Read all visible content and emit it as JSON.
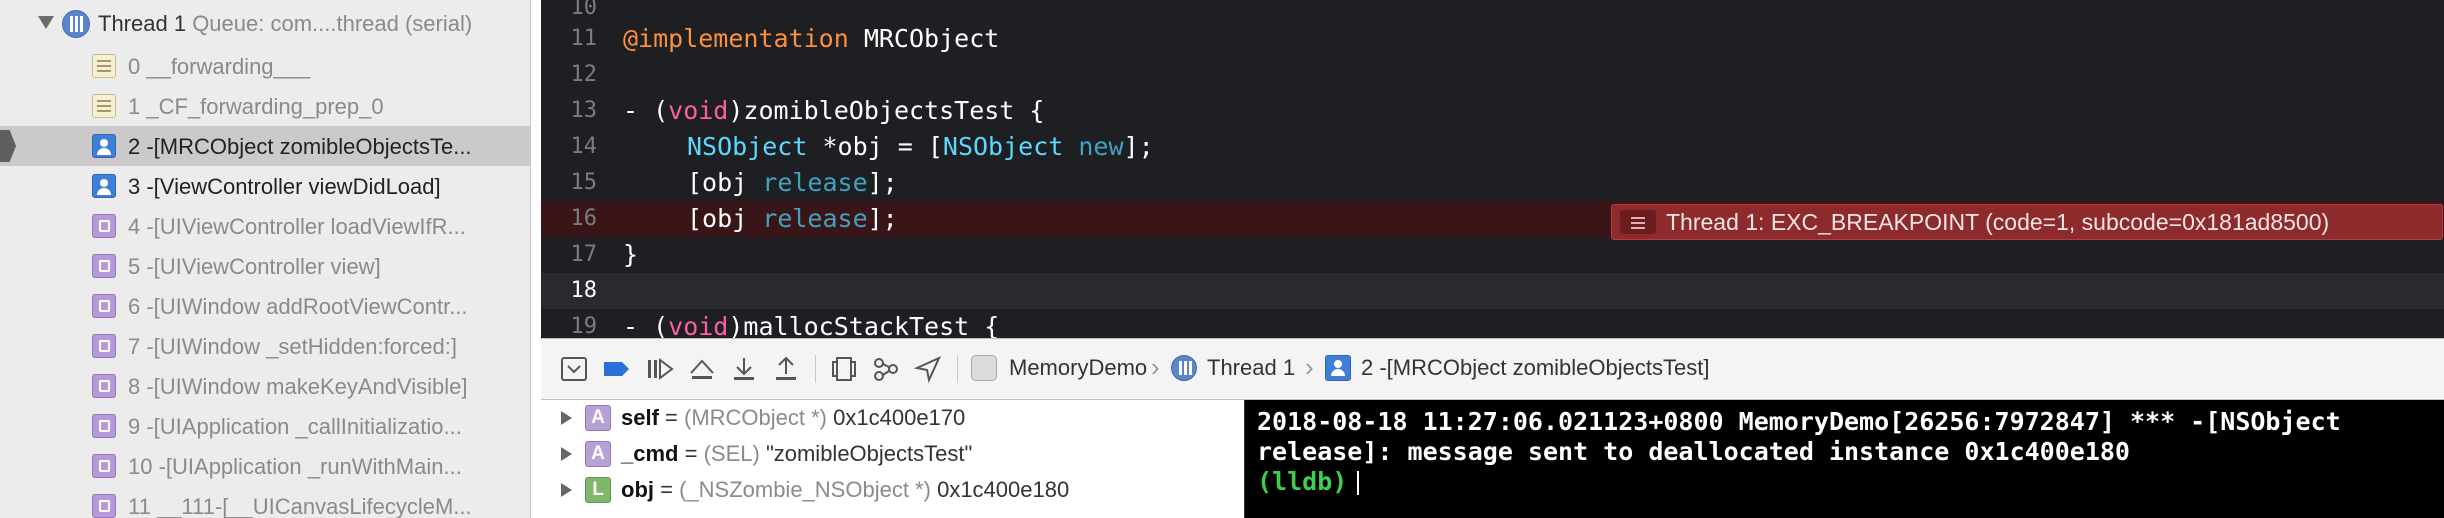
{
  "navigator": {
    "thread": {
      "name": "Thread 1",
      "queue": "Queue: com....thread (serial)"
    },
    "frames": [
      {
        "label": "0 __forwarding___",
        "icon": "system-frame-icon"
      },
      {
        "label": "1 _CF_forwarding_prep_0",
        "icon": "system-frame-icon"
      },
      {
        "label": "2 -[MRCObject zomibleObjectsTe...",
        "icon": "user-frame-icon",
        "selected": true
      },
      {
        "label": "3 -[ViewController viewDidLoad]",
        "icon": "user-frame-icon"
      },
      {
        "label": "4 -[UIViewController loadViewIfR...",
        "icon": "uikit-frame-icon"
      },
      {
        "label": "5 -[UIViewController view]",
        "icon": "uikit-frame-icon"
      },
      {
        "label": "6 -[UIWindow addRootViewContr...",
        "icon": "uikit-frame-icon"
      },
      {
        "label": "7 -[UIWindow _setHidden:forced:]",
        "icon": "uikit-frame-icon"
      },
      {
        "label": "8 -[UIWindow makeKeyAndVisible]",
        "icon": "uikit-frame-icon"
      },
      {
        "label": "9 -[UIApplication _callInitializatio...",
        "icon": "uikit-frame-icon"
      },
      {
        "label": "10 -[UIApplication _runWithMain...",
        "icon": "uikit-frame-icon"
      },
      {
        "label": "11 __111-[__UICanvasLifecycleM...",
        "icon": "uikit-frame-icon"
      }
    ]
  },
  "editor": {
    "lines": [
      {
        "num": "10"
      },
      {
        "num": "11",
        "directive": "@implementation",
        "rest": " MRCObject"
      },
      {
        "num": "12"
      },
      {
        "num": "13",
        "a": "- (",
        "kw": "void",
        "b": ")zomibleObjectsTest {"
      },
      {
        "num": "14",
        "cls1": "NSObject",
        "mid": " *obj = [",
        "cls2": "NSObject",
        "sp": " ",
        "mth": "new",
        "end": "];"
      },
      {
        "num": "15",
        "a": "[obj ",
        "mth": "release",
        "b": "];"
      },
      {
        "num": "16",
        "a": "[obj ",
        "mth": "release",
        "b": "];"
      },
      {
        "num": "17",
        "a": "}"
      },
      {
        "num": "18"
      },
      {
        "num": "19",
        "a": "- (",
        "kw": "void",
        "b": ")mallocStackTest {"
      }
    ],
    "breakpoint_message": "Thread 1: EXC_BREAKPOINT (code=1, subcode=0x181ad8500)"
  },
  "debug_bar": {
    "breadcrumb": [
      "MemoryDemo",
      "Thread 1",
      "2 -[MRCObject zomibleObjectsTest]"
    ]
  },
  "variables": [
    {
      "name": "self",
      "type": "(MRCObject *)",
      "value": "0x1c400e170",
      "badge": "A"
    },
    {
      "name": "_cmd",
      "type": "(SEL)",
      "value": "\"zomibleObjectsTest\"",
      "badge": "A"
    },
    {
      "name": "obj",
      "type": "(_NSZombie_NSObject *)",
      "value": "0x1c400e180",
      "badge": "L"
    }
  ],
  "console": {
    "output": "2018-08-18 11:27:06.021123+0800 MemoryDemo[26256:7972847] *** -[NSObject release]: message sent to deallocated instance 0x1c400e180",
    "prompt": "(lldb)"
  }
}
